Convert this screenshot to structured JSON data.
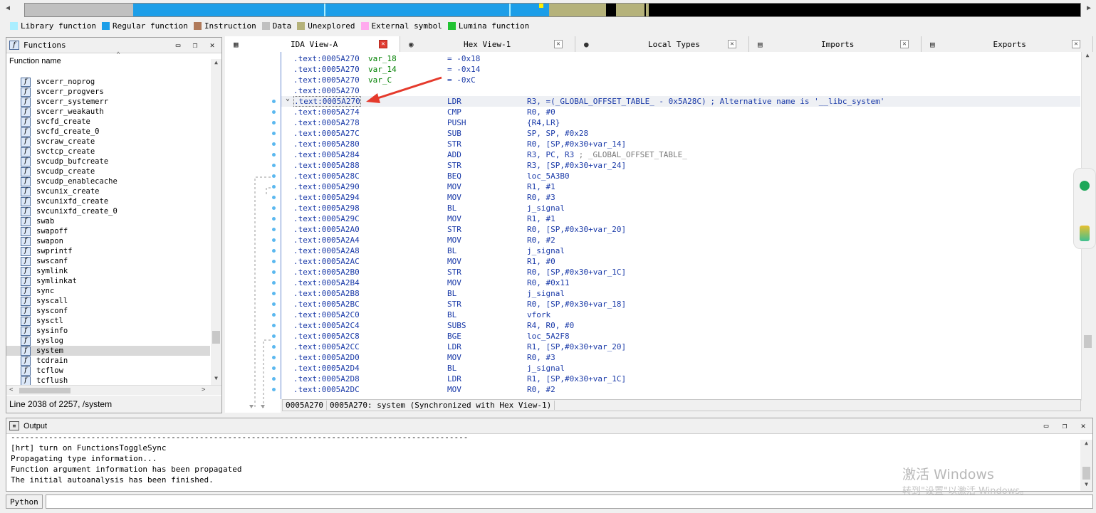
{
  "legend": [
    {
      "label": "Library function",
      "color": "#aaeeff"
    },
    {
      "label": "Regular function",
      "color": "#1c9ee8"
    },
    {
      "label": "Instruction",
      "color": "#b07a5a"
    },
    {
      "label": "Data",
      "color": "#c0c0c0"
    },
    {
      "label": "Unexplored",
      "color": "#b5b27a"
    },
    {
      "label": "External symbol",
      "color": "#ffaaee"
    },
    {
      "label": "Lumina function",
      "color": "#22c332"
    }
  ],
  "functions_panel": {
    "title": "Functions",
    "column": "Function name",
    "items": [
      "svcerr_noprog",
      "svcerr_progvers",
      "svcerr_systemerr",
      "svcerr_weakauth",
      "svcfd_create",
      "svcfd_create_0",
      "svcraw_create",
      "svctcp_create",
      "svcudp_bufcreate",
      "svcudp_create",
      "svcudp_enablecache",
      "svcunix_create",
      "svcunixfd_create",
      "svcunixfd_create_0",
      "swab",
      "swapoff",
      "swapon",
      "swprintf",
      "swscanf",
      "symlink",
      "symlinkat",
      "sync",
      "syscall",
      "sysconf",
      "sysctl",
      "sysinfo",
      "syslog",
      "system",
      "tcdrain",
      "tcflow",
      "tcflush"
    ],
    "selected": "system",
    "status": "Line 2038 of 2257, /system"
  },
  "tabs": [
    {
      "label": "IDA View-A"
    },
    {
      "label": "Hex View-1"
    },
    {
      "label": "Local Types"
    },
    {
      "label": "Imports"
    },
    {
      "label": "Exports"
    }
  ],
  "code_lines": [
    {
      "addr": ".text:0005A270",
      "label": "var_18",
      "mn": "",
      "op": "= -0x18"
    },
    {
      "addr": ".text:0005A270",
      "label": "var_14",
      "mn": "",
      "op": "= -0x14"
    },
    {
      "addr": ".text:0005A270",
      "label": "var_C",
      "mn": "",
      "op": "= -0xC"
    },
    {
      "addr": ".text:0005A270",
      "label": "",
      "mn": "",
      "op": ""
    },
    {
      "addr": ".text:0005A270",
      "label": "",
      "mn": "LDR",
      "op": "R3, =(_GLOBAL_OFFSET_TABLE_ - 0x5A28C)",
      "cm": "; Alternative name is '__libc_system'"
    },
    {
      "addr": ".text:0005A274",
      "mn": "CMP",
      "op": "R0, #0"
    },
    {
      "addr": ".text:0005A278",
      "mn": "PUSH",
      "op": "{R4,LR}"
    },
    {
      "addr": ".text:0005A27C",
      "mn": "SUB",
      "op": "SP, SP, #0x28"
    },
    {
      "addr": ".text:0005A280",
      "mn": "STR",
      "op": "R0, [SP,#0x30+var_14]"
    },
    {
      "addr": ".text:0005A284",
      "mn": "ADD",
      "op": "R3, PC, R3",
      "cm": "; _GLOBAL_OFFSET_TABLE_"
    },
    {
      "addr": ".text:0005A288",
      "mn": "STR",
      "op": "R3, [SP,#0x30+var_24]"
    },
    {
      "addr": ".text:0005A28C",
      "mn": "BEQ",
      "op": "loc_5A3B0"
    },
    {
      "addr": ".text:0005A290",
      "mn": "MOV",
      "op": "R1, #1"
    },
    {
      "addr": ".text:0005A294",
      "mn": "MOV",
      "op": "R0, #3"
    },
    {
      "addr": ".text:0005A298",
      "mn": "BL",
      "op": "j_signal"
    },
    {
      "addr": ".text:0005A29C",
      "mn": "MOV",
      "op": "R1, #1"
    },
    {
      "addr": ".text:0005A2A0",
      "mn": "STR",
      "op": "R0, [SP,#0x30+var_20]"
    },
    {
      "addr": ".text:0005A2A4",
      "mn": "MOV",
      "op": "R0, #2"
    },
    {
      "addr": ".text:0005A2A8",
      "mn": "BL",
      "op": "j_signal"
    },
    {
      "addr": ".text:0005A2AC",
      "mn": "MOV",
      "op": "R1, #0"
    },
    {
      "addr": ".text:0005A2B0",
      "mn": "STR",
      "op": "R0, [SP,#0x30+var_1C]"
    },
    {
      "addr": ".text:0005A2B4",
      "mn": "MOV",
      "op": "R0, #0x11"
    },
    {
      "addr": ".text:0005A2B8",
      "mn": "BL",
      "op": "j_signal"
    },
    {
      "addr": ".text:0005A2BC",
      "mn": "STR",
      "op": "R0, [SP,#0x30+var_18]"
    },
    {
      "addr": ".text:0005A2C0",
      "mn": "BL",
      "op": "vfork"
    },
    {
      "addr": ".text:0005A2C4",
      "mn": "SUBS",
      "op": "R4, R0, #0"
    },
    {
      "addr": ".text:0005A2C8",
      "mn": "BGE",
      "op": "loc_5A2F8"
    },
    {
      "addr": ".text:0005A2CC",
      "mn": "LDR",
      "op": "R1, [SP,#0x30+var_20]"
    },
    {
      "addr": ".text:0005A2D0",
      "mn": "MOV",
      "op": "R0, #3"
    },
    {
      "addr": ".text:0005A2D4",
      "mn": "BL",
      "op": "j_signal"
    },
    {
      "addr": ".text:0005A2D8",
      "mn": "LDR",
      "op": "R1, [SP,#0x30+var_1C]"
    },
    {
      "addr": ".text:0005A2DC",
      "mn": "MOV",
      "op": "R0, #2"
    }
  ],
  "ida_status": {
    "left": "0005A270",
    "right": "0005A270: system (Synchronized with Hex View-1)"
  },
  "output": {
    "title": "Output",
    "separator": "-------------------------------------------------------------------------------------------------",
    "lines": [
      "[hrt] turn on FunctionsToggleSync",
      "Propagating type information...",
      "Function argument information has been propagated",
      "The initial autoanalysis has been finished."
    ]
  },
  "python_label": "Python",
  "watermark": {
    "line1": "激活 Windows",
    "line2": "转到\"设置\"以激活 Windows。"
  }
}
